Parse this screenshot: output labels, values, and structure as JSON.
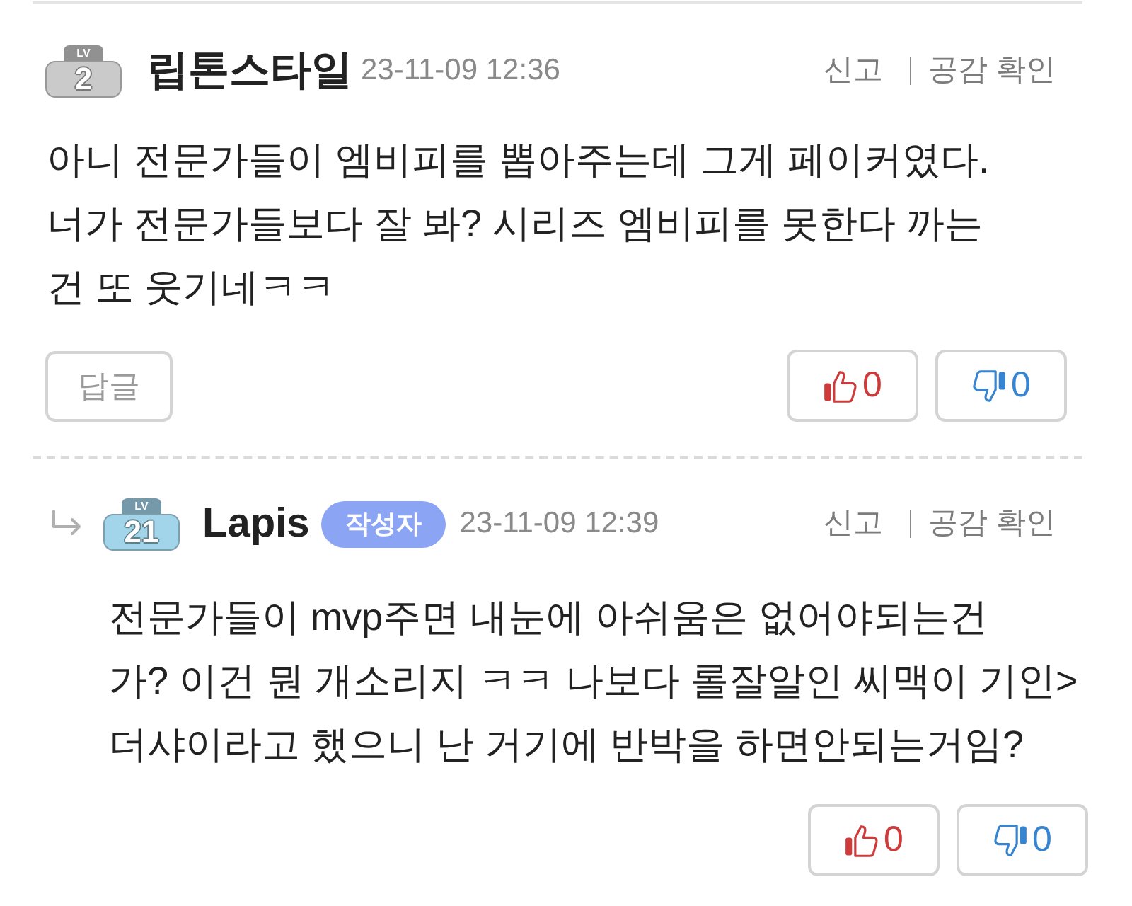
{
  "comments": [
    {
      "kind": "comment",
      "level_badge": {
        "tag": "LV",
        "number": "2",
        "color": "#cacaca"
      },
      "author": "립톤스타일",
      "date": "23-11-09 12:36",
      "actions": [
        "신고",
        "공감 확인"
      ],
      "body": "아니 전문가들이 엠비피를 뽑아주는데 그게 페이커였다.\n너가 전문가들보다 잘 봐? 시리즈 엠비피를 못한다 까는\n건 또 웃기네ㅋㅋ",
      "reply_button": "답글",
      "votes": [
        {
          "kind": "like",
          "count": "0"
        },
        {
          "kind": "dislike",
          "count": "0"
        }
      ]
    },
    {
      "kind": "reply",
      "level_badge": {
        "tag": "LV",
        "number": "21",
        "color": "#a2d5ea"
      },
      "author": "Lapis",
      "author_tag": "작성자",
      "date": "23-11-09 12:39",
      "actions": [
        "신고",
        "공감 확인"
      ],
      "body": "전문가들이 mvp주면 내눈에 아쉬움은 없어야되는건\n가? 이건 뭔 개소리지 ㅋㅋ 나보다 롤잘알인 씨맥이 기인>\n더샤이라고 했으니 난 거기에 반박을 하면안되는거임?",
      "votes": [
        {
          "kind": "like",
          "count": "0"
        },
        {
          "kind": "dislike",
          "count": "0"
        }
      ]
    }
  ]
}
